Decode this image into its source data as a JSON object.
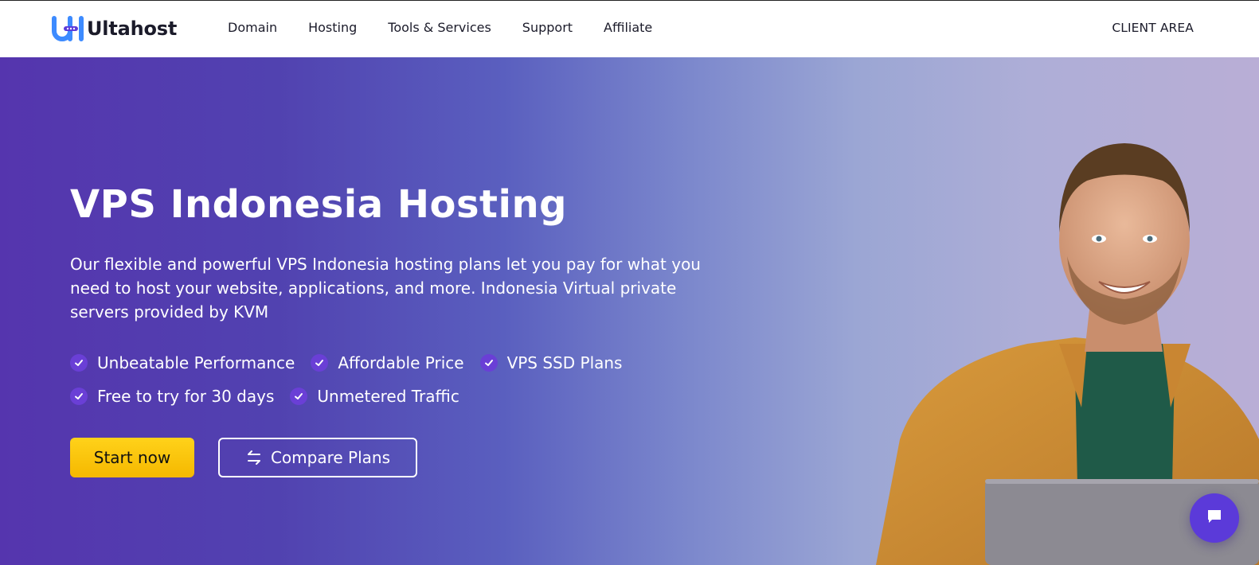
{
  "brand": {
    "name": "Ultahost",
    "accent": "#3d8bff"
  },
  "nav": {
    "items": [
      {
        "label": "Domain"
      },
      {
        "label": "Hosting"
      },
      {
        "label": "Tools & Services"
      },
      {
        "label": "Support"
      },
      {
        "label": "Affiliate"
      }
    ],
    "client_area": "CLIENT AREA"
  },
  "hero": {
    "title": "VPS Indonesia Hosting",
    "description": "Our flexible and powerful VPS Indonesia hosting plans let you pay for what you need to host your website, applications, and more. Indonesia Virtual private servers provided by KVM",
    "features": [
      "Unbeatable Performance",
      "Affordable Price",
      "VPS SSD Plans",
      "Free to try for 30 days",
      "Unmetered Traffic"
    ],
    "primary_button": "Start now",
    "secondary_button": "Compare Plans",
    "secondary_icon": "swap-arrows-icon",
    "colors": {
      "gradient_start": "#5535ae",
      "gradient_end": "#b9aed6",
      "cta": "#ffc90a",
      "check": "#6a3fd6"
    }
  },
  "chat": {
    "icon": "chat-icon",
    "color": "#5b3ad9"
  }
}
